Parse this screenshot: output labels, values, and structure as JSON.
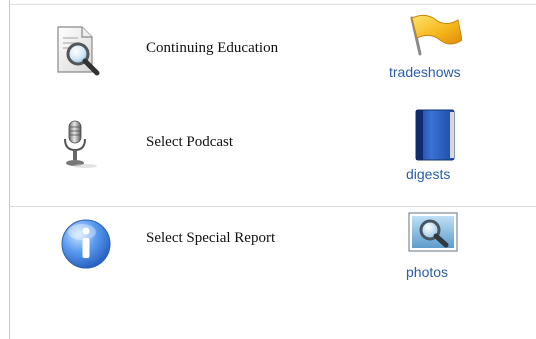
{
  "rows": [
    {
      "label": "Continuing Education",
      "icon": "document-magnifier-icon"
    },
    {
      "label": "Select Podcast",
      "icon": "microphone-icon"
    },
    {
      "label": "Select Special Report",
      "icon": "info-icon"
    }
  ],
  "links": [
    {
      "label": "tradeshows",
      "icon": "flag-icon"
    },
    {
      "label": "digests",
      "icon": "book-icon"
    },
    {
      "label": "photos",
      "icon": "photo-magnifier-icon"
    }
  ],
  "colors": {
    "link": "#2a5ea8",
    "divider": "#dcdcdc"
  }
}
